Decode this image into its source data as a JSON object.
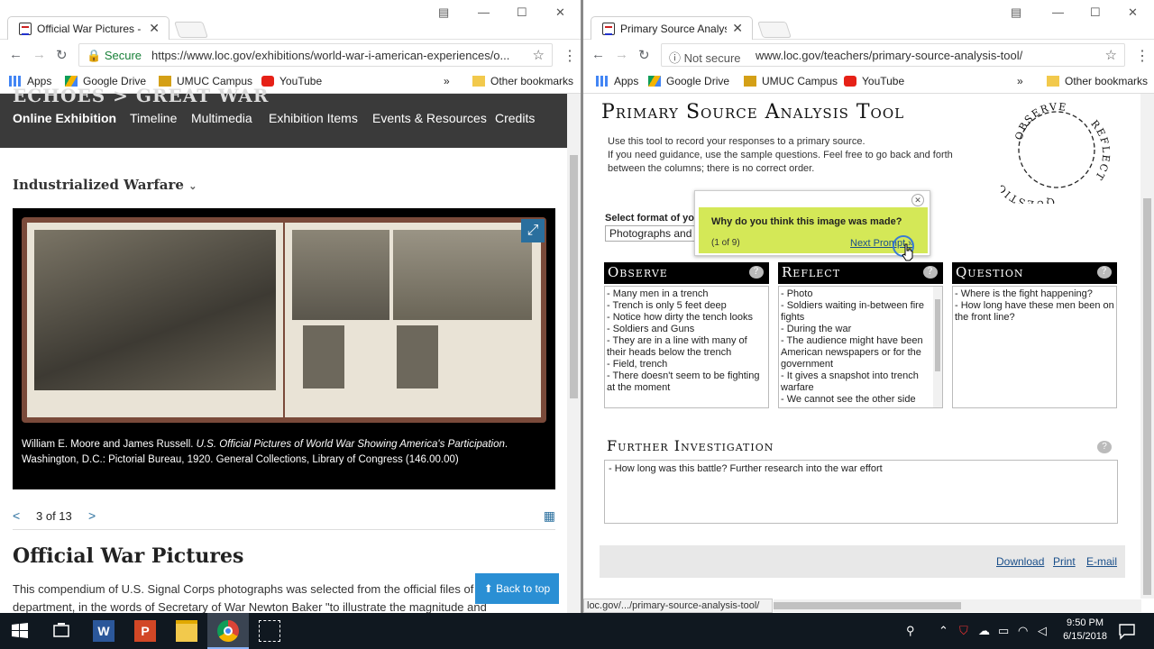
{
  "left_window": {
    "tab_title": "Official War Pictures - Ech",
    "secure_label": "Secure",
    "url": "https://www.loc.gov/exhibitions/world-war-i-american-experiences/o...",
    "bookmarks": [
      "Apps",
      "Google Drive",
      "UMUC Campus",
      "YouTube"
    ],
    "other_bookmarks": "Other bookmarks",
    "header_cut_text": "ECHOES  >  GREAT WAR",
    "nav": [
      "Online Exhibition",
      "Timeline",
      "Multimedia",
      "Exhibition Items",
      "Events & Resources",
      "Credits"
    ],
    "section_title": "Industrialized Warfare",
    "caption_plain": "William E. Moore and James Russell. ",
    "caption_italic": "U.S. Official Pictures of World War Showing America's Participation",
    "caption_tail": ".",
    "caption_line2": "Washington, D.C.: Pictorial Bureau, 1920. General Collections, Library of Congress (146.00.00)",
    "pager": "3 of 13",
    "heading": "Official War Pictures",
    "body_text": "This compendium of U.S. Signal Corps photographs was selected from the official files of the War department, in the words of Secretary of War Newton Baker \"to illustrate the magnitude and",
    "back_to_top": "Back to top"
  },
  "right_window": {
    "tab_title": "Primary Source Analysis T",
    "not_secure_label": "Not secure",
    "url": "www.loc.gov/teachers/primary-source-analysis-tool/",
    "bookmarks": [
      "Apps",
      "Google Drive",
      "UMUC Campus",
      "YouTube"
    ],
    "other_bookmarks": "Other bookmarks",
    "title": "Primary Source Analysis Tool",
    "intro_1": "Use this tool to record your responses to a primary source.",
    "intro_2": "If you need guidance, use the sample questions. Feel free to go back and forth between the columns; there is no correct order.",
    "wheel_words": [
      "OBSERVE",
      "REFLECT",
      "QUESTION"
    ],
    "select_label": "Select format of yo",
    "select_value": "Photographs and",
    "popup_question": "Why do you think this image was made?",
    "popup_count": "(1 of 9)",
    "popup_next": "Next Prompt »",
    "columns": [
      {
        "title": "Observe",
        "items": [
          "- Many men in a trench",
          "- Trench is only 5 feet deep",
          "- Notice how dirty the tench looks",
          "- Soldiers and Guns",
          "- They are in a line with many of their heads below the trench",
          "- Field, trench",
          "- There doesn't seem to be fighting at the moment"
        ]
      },
      {
        "title": "Reflect",
        "items": [
          "- Photo",
          "- Soldiers waiting in-between fire fights",
          "- During the war",
          "- The audience might have been American newspapers or for the government",
          "-  It gives a snapshot into trench warfare",
          "- We cannot see the other side"
        ]
      },
      {
        "title": "Question",
        "items": [
          "- Where is the fight happening?",
          "- How long have these men been on the front line?"
        ]
      }
    ],
    "further_title": "Further Investigation",
    "further_text": "- How long was this battle? Further research into the war effort",
    "footer_links": [
      "Download",
      "Print",
      "E-mail"
    ],
    "status_url": "loc.gov/.../primary-source-analysis-tool/"
  },
  "taskbar": {
    "time": "9:50 PM",
    "date": "6/15/2018"
  },
  "colors": {
    "nav_bg": "#3a3a3a",
    "popup_green": "#d4e857",
    "link_blue": "#1a4f8a",
    "back_to_top": "#2a8fd4",
    "taskbar": "#101820"
  }
}
